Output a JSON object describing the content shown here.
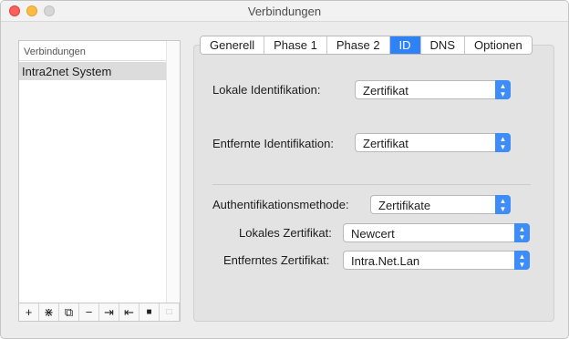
{
  "window": {
    "title": "Verbindungen"
  },
  "connections": {
    "header": "Verbindungen",
    "items": [
      "Intra2net System"
    ]
  },
  "toolbar": {
    "buttons": [
      {
        "icon": "plus-icon",
        "glyph": "+"
      },
      {
        "icon": "wizard-icon",
        "glyph": "⋇"
      },
      {
        "icon": "duplicate-icon",
        "glyph": "⧉"
      },
      {
        "icon": "minus-icon",
        "glyph": "−"
      },
      {
        "icon": "import-icon",
        "glyph": "⇥"
      },
      {
        "icon": "export-icon",
        "glyph": "⇤"
      },
      {
        "icon": "lock-icon",
        "glyph": "🔒"
      },
      {
        "icon": "unlock-icon",
        "glyph": "🔓"
      }
    ]
  },
  "tabs": [
    "Generell",
    "Phase 1",
    "Phase 2",
    "ID",
    "DNS",
    "Optionen"
  ],
  "active_tab": "ID",
  "form": {
    "local_id_label": "Lokale Identifikation:",
    "local_id_value": "Zertifikat",
    "remote_id_label": "Entfernte Identifikation:",
    "remote_id_value": "Zertifikat",
    "auth_method_label": "Authentifikationsmethode:",
    "auth_method_value": "Zertifikate",
    "local_cert_label": "Lokales Zertifikat:",
    "local_cert_value": "Newcert",
    "remote_cert_label": "Entferntes Zertifikat:",
    "remote_cert_value": "Intra.Net.Lan"
  },
  "colors": {
    "accent": "#2f82f6",
    "close": "#fc605c",
    "minimize": "#fdbc40"
  }
}
